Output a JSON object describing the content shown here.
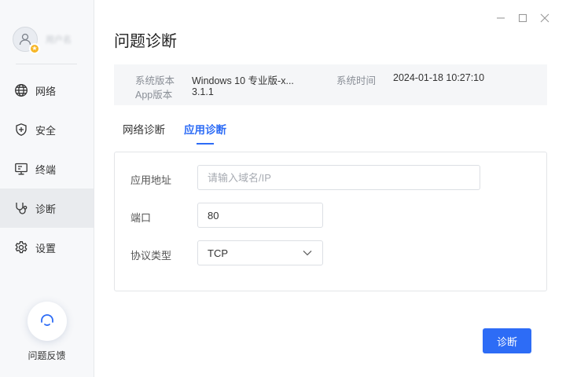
{
  "user": {
    "name": "用户名"
  },
  "sidebar": {
    "items": [
      {
        "label": "网络",
        "icon": "globe-icon"
      },
      {
        "label": "安全",
        "icon": "shield-icon"
      },
      {
        "label": "终端",
        "icon": "monitor-icon"
      },
      {
        "label": "诊断",
        "icon": "stethoscope-icon",
        "active": true
      },
      {
        "label": "设置",
        "icon": "gear-icon"
      }
    ],
    "feedback_label": "问题反馈"
  },
  "page": {
    "title": "问题诊断"
  },
  "info": {
    "os_label": "系统版本",
    "os_value": "Windows 10 专业版-x...",
    "time_label": "系统时间",
    "time_value": "2024-01-18 10:27:10",
    "app_label": "App版本",
    "app_value": "3.1.1"
  },
  "tabs": [
    {
      "label": "网络诊断",
      "active": false
    },
    {
      "label": "应用诊断",
      "active": true
    }
  ],
  "form": {
    "address_label": "应用地址",
    "address_placeholder": "请输入域名/IP",
    "port_label": "端口",
    "port_value": "80",
    "protocol_label": "协议类型",
    "protocol_value": "TCP"
  },
  "actions": {
    "submit_label": "诊断"
  },
  "colors": {
    "accent": "#2d6cf6",
    "sidebar_bg": "#f7f8fa",
    "active_item_bg": "#e9ebee",
    "badge": "#f6b626"
  }
}
